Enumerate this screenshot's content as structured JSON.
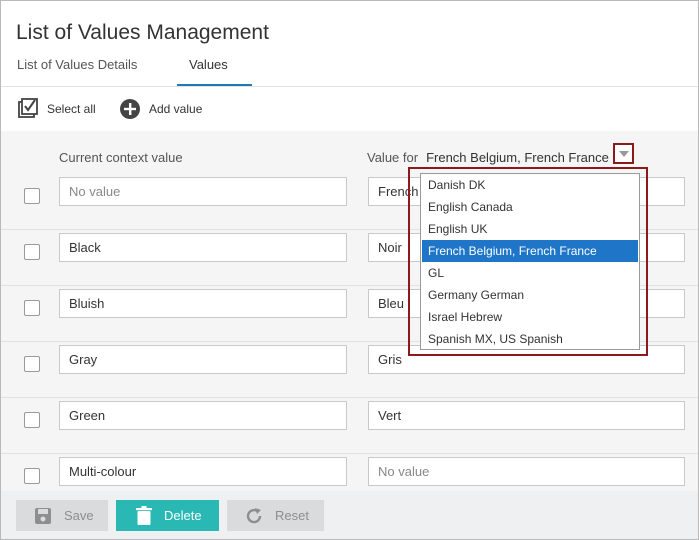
{
  "page": {
    "title": "List of Values Management"
  },
  "tabs": [
    {
      "label": "List of Values Details",
      "active": false
    },
    {
      "label": "Values",
      "active": true
    }
  ],
  "toolbar": {
    "select_all": "Select all",
    "add_value": "Add value"
  },
  "columns": {
    "current": "Current context value",
    "value_for_label": "Value for",
    "value_for_selected": "French Belgium, French France"
  },
  "rows": [
    {
      "left": "No value",
      "left_placeholder": true,
      "right": "French",
      "right_placeholder": false
    },
    {
      "left": "Black",
      "left_placeholder": false,
      "right": "Noir",
      "right_placeholder": false
    },
    {
      "left": "Bluish",
      "left_placeholder": false,
      "right": "Bleu",
      "right_placeholder": false
    },
    {
      "left": "Gray",
      "left_placeholder": false,
      "right": "Gris",
      "right_placeholder": false
    },
    {
      "left": "Green",
      "left_placeholder": false,
      "right": "Vert",
      "right_placeholder": false
    },
    {
      "left": "Multi-colour",
      "left_placeholder": false,
      "right": "No value",
      "right_placeholder": true
    }
  ],
  "dropdown": {
    "options": [
      "Danish DK",
      "English Canada",
      "English UK",
      "French Belgium, French France",
      "GL",
      "Germany German",
      "Israel Hebrew",
      "Spanish MX, US Spanish"
    ],
    "selected_index": 3
  },
  "footer": {
    "save": "Save",
    "delete": "Delete",
    "reset": "Reset"
  },
  "colors": {
    "accent": "#1d7ab5",
    "selection": "#1f76c9",
    "delete": "#29b8b4",
    "highlight": "#8b1a1a"
  },
  "icons": {
    "select_all": "checkbox-check-icon",
    "add_value": "plus-circle-icon",
    "save": "floppy-disk-icon",
    "delete": "trash-icon",
    "reset": "refresh-icon",
    "dropdown": "chevron-down-icon"
  }
}
